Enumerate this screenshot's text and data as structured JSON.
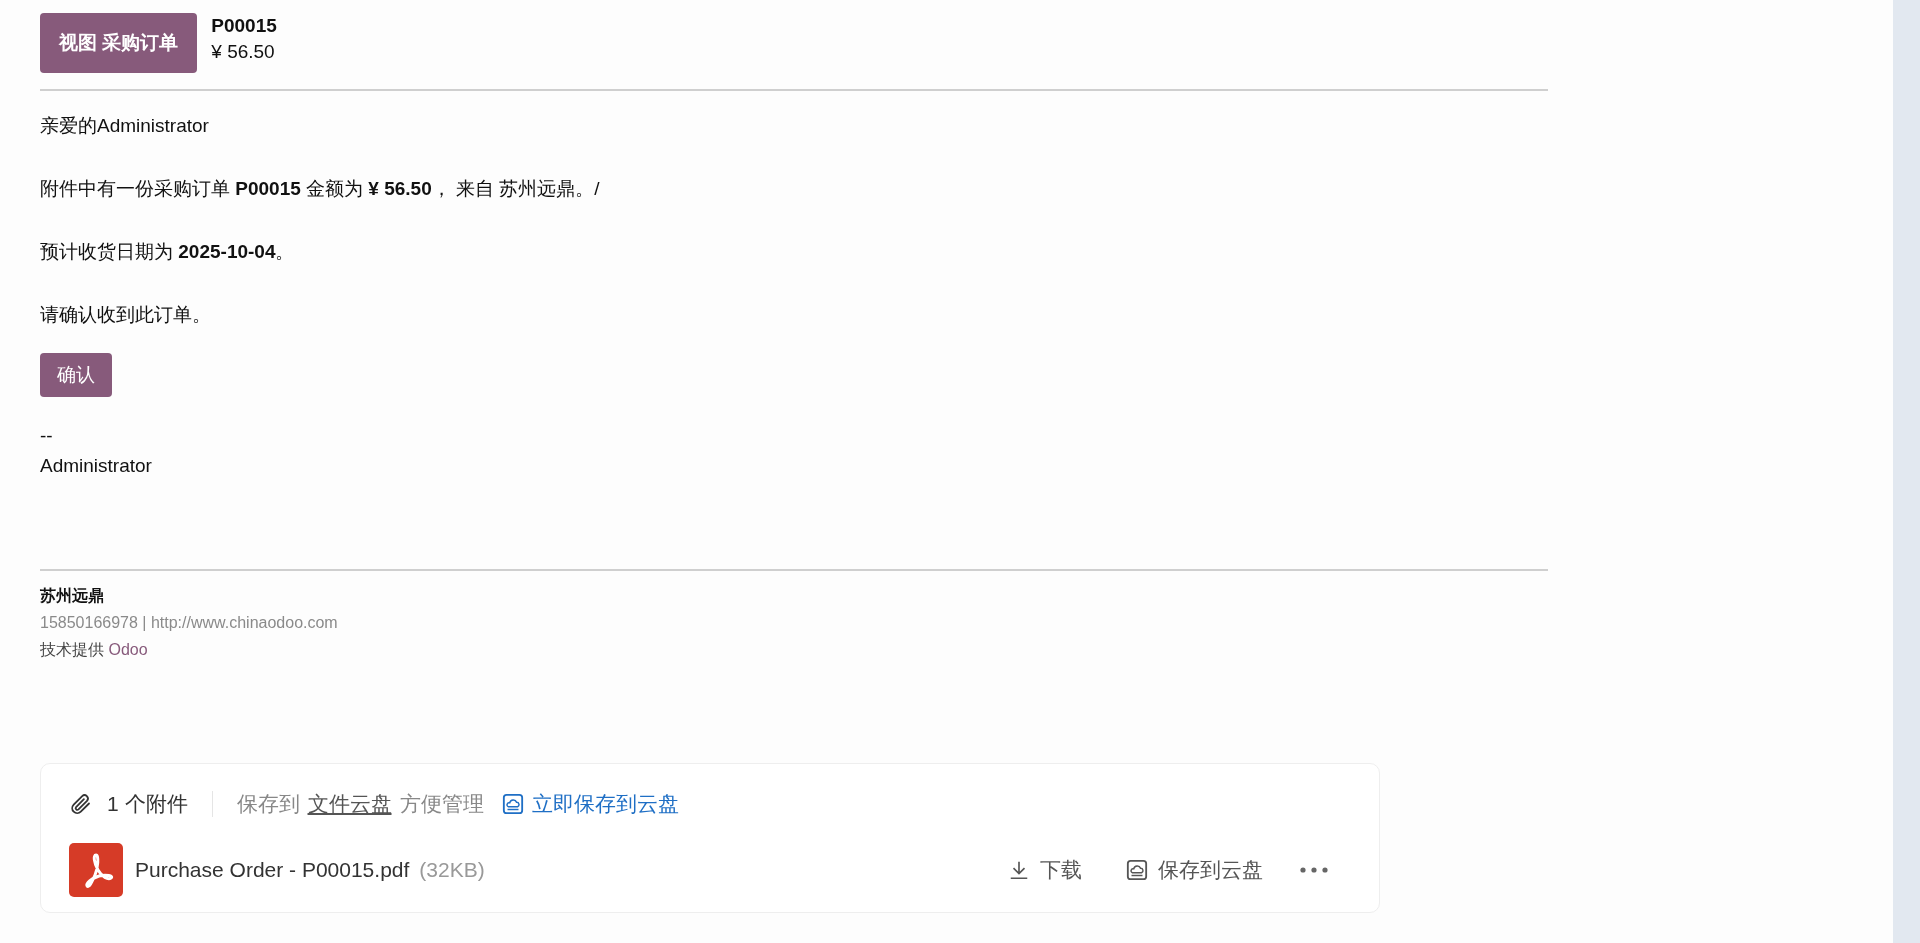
{
  "header": {
    "button": "视图 采购订单",
    "order": "P00015",
    "amount": "¥ 56.50"
  },
  "body": {
    "greeting": "亲爱的Administrator",
    "paragraphs": [
      "附件中有一份采购订单 **P00015** 金额为 **¥ 56.50**， 来自 苏州远鼎。/",
      "预计收货日期为 **2025-10-04**。",
      "请确认收到此订单。"
    ],
    "confirm_button": "确认",
    "signature_dash": "--",
    "signature": "Administrator"
  },
  "footer": {
    "company": "苏州远鼎",
    "contact": "15850166978 | http://www.chinaodoo.com",
    "powered_prefix": "技术提供",
    "powered_link": "Odoo"
  },
  "attachments": {
    "count": "1 个附件",
    "save_prefix": "保存到",
    "save_link": "文件云盘",
    "save_suffix": "方便管理",
    "save_now": "立即保存到云盘",
    "files": [
      {
        "name": "Purchase Order - P00015.pdf",
        "size": "(32KB)",
        "download": "下载",
        "save": "保存到云盘"
      }
    ]
  }
}
